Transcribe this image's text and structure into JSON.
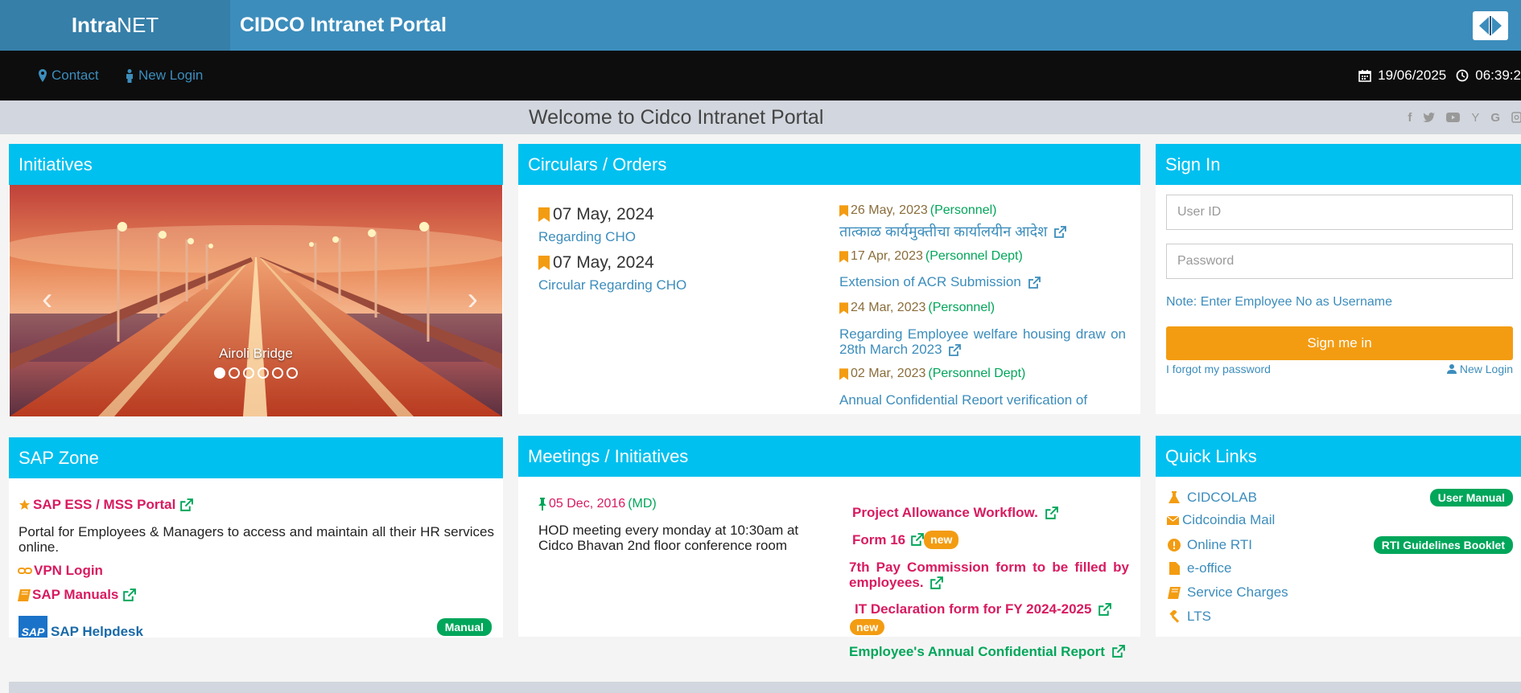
{
  "header": {
    "brand_bold": "Intra",
    "brand_rest": "NET",
    "title": "CIDCO Intranet Portal"
  },
  "nav": {
    "contact": "Contact",
    "new_login": "New Login",
    "date": "19/06/2025",
    "time": "06:39:2"
  },
  "welcome": "Welcome to Cidco Intranet Portal",
  "socials": [
    "facebook-icon",
    "twitter-icon",
    "youtube-icon",
    "yahoo-icon",
    "google-icon",
    "instagram-icon"
  ],
  "initiatives": {
    "title": "Initiatives",
    "caption": "Airoli Bridge",
    "slide_count": 6,
    "active_slide": 0
  },
  "circulars": {
    "title": "Circulars / Orders",
    "left": [
      {
        "date": "07 May, 2024",
        "text": "Regarding CHO"
      },
      {
        "date": "07 May, 2024",
        "text": "Circular Regarding CHO"
      }
    ],
    "right": [
      {
        "date": "26 May, 2023",
        "dept": "(Personnel)",
        "text": "तात्काळ कार्यमुक्तीचा कार्यालयीन आदेश"
      },
      {
        "date": "17 Apr, 2023",
        "dept": "(Personnel Dept)",
        "text": "Extension of ACR Submission"
      },
      {
        "date": "24 Mar, 2023",
        "dept": "(Personnel)",
        "text": "Regarding Employee welfare housing draw on 28th March 2023"
      },
      {
        "date": "02 Mar, 2023",
        "dept": "(Personnel Dept)",
        "text": "Annual Confidential Report verification of"
      }
    ]
  },
  "signin": {
    "title": "Sign In",
    "user_placeholder": "User ID",
    "pass_placeholder": "Password",
    "note": "Note: Enter Employee No as Username",
    "button": "Sign me in",
    "forgot": "I forgot my password",
    "new_login": "New Login"
  },
  "sap": {
    "title": "SAP Zone",
    "ess": "SAP ESS / MSS Portal",
    "desc": "Portal for Employees & Managers to access and maintain all their HR services online.",
    "vpn": "VPN Login",
    "manuals": "SAP Manuals",
    "helpdesk": "SAP Helpdesk",
    "manual_badge": "Manual"
  },
  "meetings": {
    "title": "Meetings / Initiatives",
    "date": "05 Dec, 2016",
    "dept": "(MD)",
    "text": "HOD meeting every monday at 10:30am at Cidco Bhavan 2nd floor conference room",
    "links": {
      "project": "Project Allowance Workflow.",
      "form16": "Form 16",
      "pay": "7th Pay Commission form to be filled by employees.",
      "it": "IT Declaration form for FY 2024-2025",
      "acr": "Employee's Annual Confidential Report"
    },
    "new_badge": "new"
  },
  "quicklinks": {
    "title": "Quick Links",
    "items": [
      {
        "label": "CIDCOLAB",
        "badge": "User Manual"
      },
      {
        "label": "Cidcoindia Mail",
        "badge": ""
      },
      {
        "label": "Online RTI",
        "badge": "RTI Guidelines Booklet"
      },
      {
        "label": "e-office",
        "badge": ""
      },
      {
        "label": "Service Charges",
        "badge": ""
      },
      {
        "label": "LTS",
        "badge": ""
      }
    ]
  },
  "colors": {
    "header": "#3c8dbc",
    "panel_head": "#00c0ef",
    "orange": "#f39c12",
    "green": "#00a65a",
    "pink": "#d81b60"
  }
}
